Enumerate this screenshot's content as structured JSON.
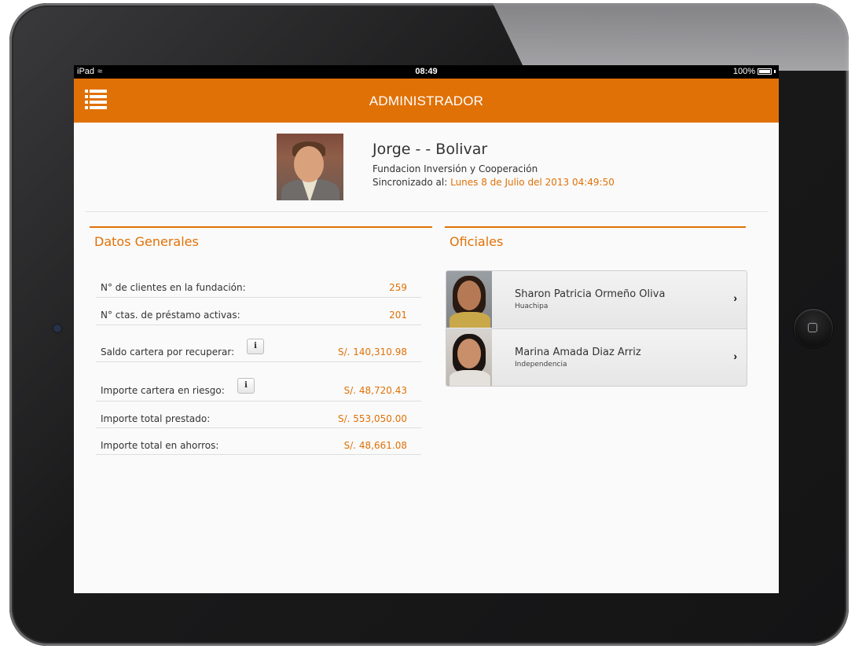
{
  "status_bar": {
    "device": "iPad",
    "time": "08:49",
    "battery": "100%"
  },
  "nav": {
    "title": "ADMINISTRADOR",
    "menu_icon": "list-menu-icon",
    "color": "#e07107"
  },
  "profile": {
    "name": "Jorge - - Bolivar",
    "organization": "Fundacion Inversión y Cooperación",
    "sync_label": "Sincronizado al:",
    "sync_date": "Lunes 8 de Julio del 2013 04:49:50"
  },
  "general": {
    "title": "Datos Generales",
    "rows": [
      {
        "label": "N° de clientes en la fundación:",
        "value": "259",
        "info": false
      },
      {
        "label": "N° ctas. de préstamo activas:",
        "value": "201",
        "info": false
      },
      {
        "label": "Saldo cartera por recuperar:",
        "value": "S/. 140,310.98",
        "info": true
      },
      {
        "label": "Importe cartera en riesgo:",
        "value": "S/. 48,720.43",
        "info": true
      },
      {
        "label": "Importe total prestado:",
        "value": "S/. 553,050.00",
        "info": false
      },
      {
        "label": "Importe total en ahorros:",
        "value": "S/. 48,661.08",
        "info": false
      }
    ],
    "info_glyph": "i"
  },
  "officers": {
    "title": "Oficiales",
    "items": [
      {
        "name": "Sharon Patricia Ormeño Oliva",
        "location": "Huachipa"
      },
      {
        "name": "Marina Amada Diaz Arriz",
        "location": "Independencia"
      }
    ],
    "chevron": "›"
  }
}
